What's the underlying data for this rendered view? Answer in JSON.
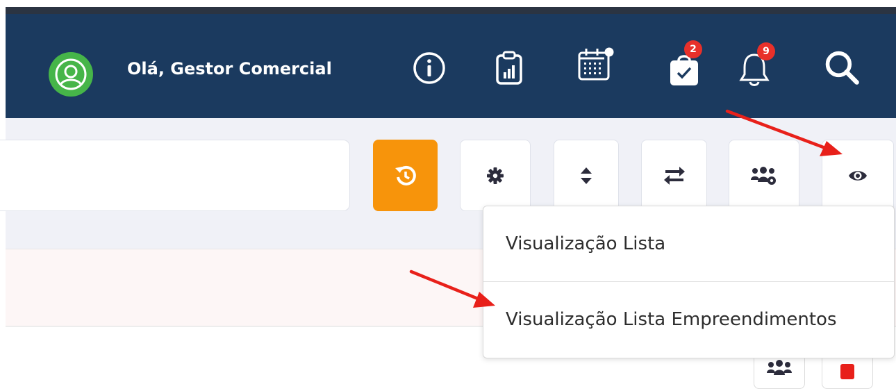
{
  "header": {
    "greeting": "Olá, Gestor Comercial",
    "icons": [
      "user-avatar-icon",
      "info-icon",
      "clipboard-report-icon",
      "calendar-icon",
      "task-bag-icon",
      "bell-icon",
      "search-icon"
    ],
    "tasks_badge": "2",
    "notifications_badge": "9",
    "background_color": "#1b3a5f"
  },
  "toolbar": {
    "buttons": [
      "history-icon",
      "gear-icon",
      "sort-icon",
      "swap-icon",
      "users-gear-icon",
      "eye-icon"
    ],
    "history_button_color": "#f7940b"
  },
  "view_menu": {
    "items": [
      {
        "label": "Visualização Lista"
      },
      {
        "label": "Visualização Lista Empreendimentos"
      }
    ]
  },
  "annotations": {
    "arrow_color": "#e8201a"
  }
}
